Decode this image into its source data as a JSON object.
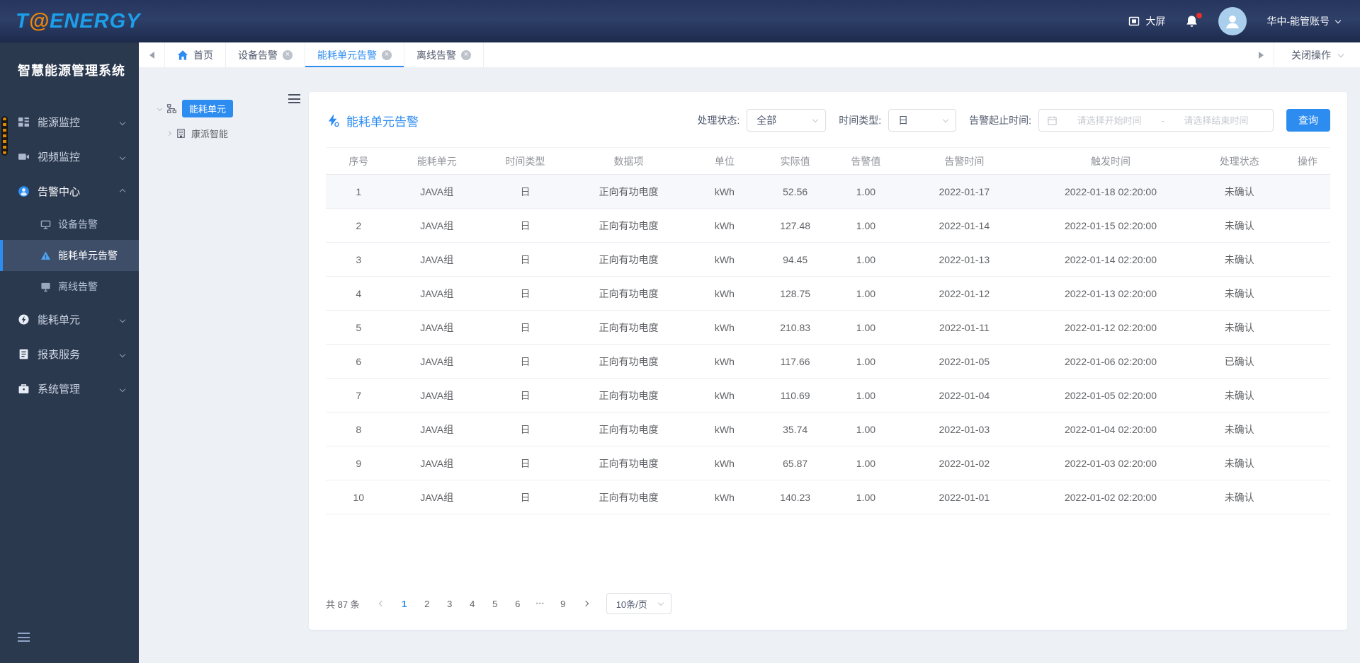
{
  "logo": {
    "prefix": "T",
    "at": "@",
    "suffix": "ENERGY"
  },
  "header": {
    "big_screen": "大屏",
    "account": "华中-能管账号"
  },
  "sidebar": {
    "title": "智慧能源管理系统",
    "items": {
      "energy_monitor": "能源监控",
      "video_monitor": "视频监控",
      "alarm_center": "告警中心",
      "device_alarm": "设备告警",
      "unit_alarm": "能耗单元告警",
      "offline_alarm": "离线告警",
      "energy_unit": "能耗单元",
      "report_service": "报表服务",
      "system_manage": "系统管理"
    }
  },
  "tabbar": {
    "tabs": {
      "home": "首页",
      "device_alarm": "设备告警",
      "unit_alarm": "能耗单元告警",
      "offline_alarm": "离线告警"
    },
    "close_ops": "关闭操作"
  },
  "tree": {
    "root": "能耗单元",
    "child": "康派智能"
  },
  "panel": {
    "title": "能耗单元告警",
    "filters": {
      "status_label": "处理状态:",
      "status_value": "全部",
      "time_type_label": "时间类型:",
      "time_type_value": "日",
      "range_label": "告警起止时间:",
      "start_placeholder": "请选择开始时间",
      "range_separator": "-",
      "end_placeholder": "请选择结束时间",
      "query_button": "查询"
    },
    "table": {
      "columns": [
        "序号",
        "能耗单元",
        "时间类型",
        "数据项",
        "单位",
        "实际值",
        "告警值",
        "告警时间",
        "触发时间",
        "处理状态",
        "操作"
      ],
      "rows": [
        {
          "no": "1",
          "unit": "JAVA组",
          "time_type": "日",
          "data_item": "正向有功电度",
          "uom": "kWh",
          "actual": "52.56",
          "threshold": "1.00",
          "alarm_date": "2022-01-17",
          "trigger_time": "2022-01-18 02:20:00",
          "status": "未确认",
          "op": ""
        },
        {
          "no": "2",
          "unit": "JAVA组",
          "time_type": "日",
          "data_item": "正向有功电度",
          "uom": "kWh",
          "actual": "127.48",
          "threshold": "1.00",
          "alarm_date": "2022-01-14",
          "trigger_time": "2022-01-15 02:20:00",
          "status": "未确认",
          "op": ""
        },
        {
          "no": "3",
          "unit": "JAVA组",
          "time_type": "日",
          "data_item": "正向有功电度",
          "uom": "kWh",
          "actual": "94.45",
          "threshold": "1.00",
          "alarm_date": "2022-01-13",
          "trigger_time": "2022-01-14 02:20:00",
          "status": "未确认",
          "op": ""
        },
        {
          "no": "4",
          "unit": "JAVA组",
          "time_type": "日",
          "data_item": "正向有功电度",
          "uom": "kWh",
          "actual": "128.75",
          "threshold": "1.00",
          "alarm_date": "2022-01-12",
          "trigger_time": "2022-01-13 02:20:00",
          "status": "未确认",
          "op": ""
        },
        {
          "no": "5",
          "unit": "JAVA组",
          "time_type": "日",
          "data_item": "正向有功电度",
          "uom": "kWh",
          "actual": "210.83",
          "threshold": "1.00",
          "alarm_date": "2022-01-11",
          "trigger_time": "2022-01-12 02:20:00",
          "status": "未确认",
          "op": ""
        },
        {
          "no": "6",
          "unit": "JAVA组",
          "time_type": "日",
          "data_item": "正向有功电度",
          "uom": "kWh",
          "actual": "117.66",
          "threshold": "1.00",
          "alarm_date": "2022-01-05",
          "trigger_time": "2022-01-06 02:20:00",
          "status": "已确认",
          "op": ""
        },
        {
          "no": "7",
          "unit": "JAVA组",
          "time_type": "日",
          "data_item": "正向有功电度",
          "uom": "kWh",
          "actual": "110.69",
          "threshold": "1.00",
          "alarm_date": "2022-01-04",
          "trigger_time": "2022-01-05 02:20:00",
          "status": "未确认",
          "op": ""
        },
        {
          "no": "8",
          "unit": "JAVA组",
          "time_type": "日",
          "data_item": "正向有功电度",
          "uom": "kWh",
          "actual": "35.74",
          "threshold": "1.00",
          "alarm_date": "2022-01-03",
          "trigger_time": "2022-01-04 02:20:00",
          "status": "未确认",
          "op": ""
        },
        {
          "no": "9",
          "unit": "JAVA组",
          "time_type": "日",
          "data_item": "正向有功电度",
          "uom": "kWh",
          "actual": "65.87",
          "threshold": "1.00",
          "alarm_date": "2022-01-02",
          "trigger_time": "2022-01-03 02:20:00",
          "status": "未确认",
          "op": ""
        },
        {
          "no": "10",
          "unit": "JAVA组",
          "time_type": "日",
          "data_item": "正向有功电度",
          "uom": "kWh",
          "actual": "140.23",
          "threshold": "1.00",
          "alarm_date": "2022-01-01",
          "trigger_time": "2022-01-02 02:20:00",
          "status": "未确认",
          "op": ""
        }
      ]
    },
    "pagination": {
      "total": "共 87 条",
      "pages": [
        {
          "label": "1",
          "active": true
        },
        {
          "label": "2"
        },
        {
          "label": "3"
        },
        {
          "label": "4"
        },
        {
          "label": "5"
        },
        {
          "label": "6"
        },
        {
          "label": "•••",
          "ellipsis": true
        },
        {
          "label": "9"
        }
      ],
      "page_size": "10条/页"
    }
  },
  "colors": {
    "accent": "#2d8cf0",
    "logo_blue": "#1ba0e9",
    "logo_orange": "#f28705",
    "sidebar_bg": "#2b394f",
    "header_navy": "#26355c",
    "notification_dot": "#e8302a"
  }
}
